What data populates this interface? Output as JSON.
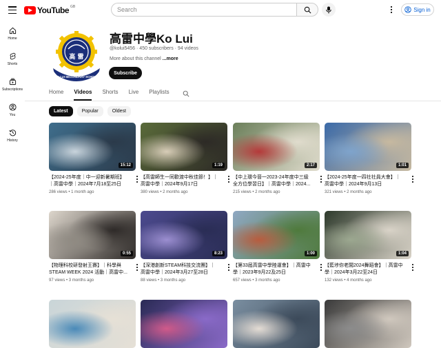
{
  "header": {
    "logo_text": "YouTube",
    "region": "GB",
    "search_placeholder": "Search",
    "signin_label": "Sign in"
  },
  "sidebar": {
    "items": [
      {
        "label": "Home",
        "icon": "home-icon"
      },
      {
        "label": "Shorts",
        "icon": "shorts-icon"
      },
      {
        "label": "Subscriptions",
        "icon": "subscriptions-icon"
      },
      {
        "label": "You",
        "icon": "you-icon"
      },
      {
        "label": "History",
        "icon": "history-icon"
      }
    ]
  },
  "channel": {
    "title": "高雷中學Ko Lui",
    "meta": "@kolui5456 · 450 subscribers · 94 videos",
    "about": "More about this channel",
    "about_more": "...more",
    "subscribe_label": "Subscribe",
    "logo_text_top": "高雷",
    "logo_text_bottom": "KO LUI SECONDARY SCHOOL",
    "logo_colors": {
      "ring": "#f2c200",
      "navy": "#1b2f7a"
    }
  },
  "tabs": [
    {
      "label": "Home",
      "active": false
    },
    {
      "label": "Videos",
      "active": true
    },
    {
      "label": "Shorts",
      "active": false
    },
    {
      "label": "Live",
      "active": false
    },
    {
      "label": "Playlists",
      "active": false
    }
  ],
  "chips": [
    {
      "label": "Latest",
      "active": true
    },
    {
      "label": "Popular",
      "active": false
    },
    {
      "label": "Oldest",
      "active": false
    }
  ],
  "videos": [
    {
      "title": "【2024-25年度｜中一迎新暑期班】｜高雷中學｜2024年7月18至25日",
      "meta": "286 views • 1 month ago",
      "duration": "15:12",
      "colors": [
        "#3f6e8c",
        "#c9d4dc",
        "#2b3a4a"
      ]
    },
    {
      "title": "【高雷師生一同歡渡中秋佳節！】｜高雷中學｜2024年9月17日",
      "meta": "380 views • 2 months ago",
      "duration": "1:19",
      "colors": [
        "#5a6b3a",
        "#d8cdb8",
        "#2d2a26"
      ]
    },
    {
      "title": "【中上環今晉一2023-24年度中三級全方位學習日】｜高雷中學｜2024...",
      "meta": "215 views • 2 months ago",
      "duration": "2:17",
      "colors": [
        "#6b7f5a",
        "#b53a3a",
        "#e0dccd"
      ]
    },
    {
      "title": "【2024-25年度一四社社員大會】｜高雷中學｜2024年9月13日",
      "meta": "321 views • 2 months ago",
      "duration": "1:01",
      "colors": [
        "#3b6aa8",
        "#7fa4cc",
        "#c7b9a0"
      ]
    },
    {
      "title": "【物理科校研發射王賽】｜科學與STEAM WEEK 2024 活動｜高雷中...",
      "meta": "97 views • 3 months ago",
      "duration": "0:55",
      "colors": [
        "#ddd6cc",
        "#8f8a82",
        "#2e2a28"
      ]
    },
    {
      "title": "【深港創新STEAM科技交流團】｜高雷中學｜2024年3月27至28日",
      "meta": "88 views • 3 months ago",
      "duration": "8:23",
      "colors": [
        "#4c4a8e",
        "#9b8ed0",
        "#2a2d55"
      ]
    },
    {
      "title": "【第33屆高雷中學陸運會】｜高雷中學｜2023年9月22及25日",
      "meta": "657 views • 3 months ago",
      "duration": "1:00",
      "colors": [
        "#8fa8c3",
        "#b85c3e",
        "#4f7a3c"
      ]
    },
    {
      "title": "【藍埗你老闆2024舞蹈會】｜高雷中學｜2024年3月22至24日",
      "meta": "132 views • 4 months ago",
      "duration": "1:04",
      "colors": [
        "#2e3a2c",
        "#9ca890",
        "#d9d3c8"
      ]
    },
    {
      "title": "",
      "meta": "",
      "duration": "",
      "colors": [
        "#c9d5d8",
        "#4a8ab8",
        "#e6e0d6"
      ]
    },
    {
      "title": "",
      "meta": "",
      "duration": "",
      "colors": [
        "#2a2a55",
        "#d05a8a",
        "#8a6ac8"
      ]
    },
    {
      "title": "",
      "meta": "",
      "duration": "",
      "colors": [
        "#7a8ea0",
        "#e4dcd4",
        "#3c4a5a"
      ]
    },
    {
      "title": "",
      "meta": "",
      "duration": "",
      "colors": [
        "#3a3a3a",
        "#8c8c8c",
        "#d0c8be"
      ]
    }
  ]
}
